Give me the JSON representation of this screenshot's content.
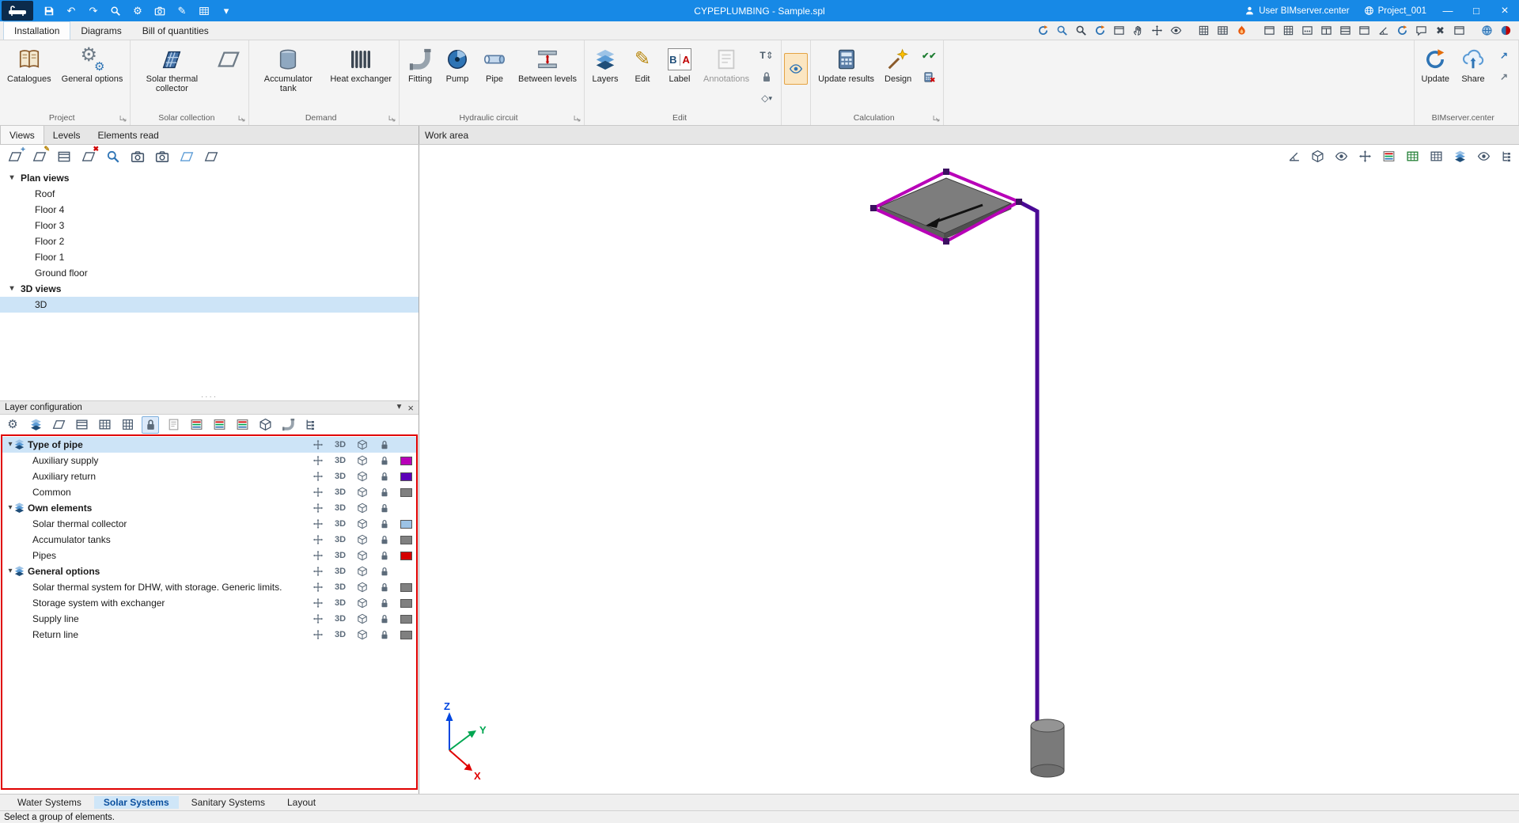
{
  "titlebar": {
    "title": "CYPEPLUMBING - Sample.spl",
    "user": "User BIMserver.center",
    "project": "Project_001"
  },
  "menu_tabs": {
    "installation": "Installation",
    "diagrams": "Diagrams",
    "bill": "Bill of quantities"
  },
  "ribbon": {
    "groups": {
      "project": "Project",
      "solar": "Solar collection",
      "demand": "Demand",
      "hydraulic": "Hydraulic circuit",
      "edit": "Edit",
      "calculation": "Calculation",
      "bim": "BIMserver.center"
    },
    "buttons": {
      "catalogues": "Catalogues",
      "general_options": "General options",
      "solar_collector": "Solar thermal collector",
      "accumulator_tank": "Accumulator tank",
      "heat_exchanger": "Heat exchanger",
      "fitting": "Fitting",
      "pump": "Pump",
      "pipe": "Pipe",
      "between_levels": "Between levels",
      "layers": "Layers",
      "edit": "Edit",
      "label": "Label",
      "annotations": "Annotations",
      "update_results": "Update results",
      "design": "Design",
      "update": "Update",
      "share": "Share"
    }
  },
  "caption": {
    "views": "Views",
    "levels": "Levels",
    "elements_read": "Elements read",
    "work_area": "Work area"
  },
  "tree": {
    "plan_views": "Plan views",
    "items": [
      "Roof",
      "Floor 4",
      "Floor 3",
      "Floor 2",
      "Floor 1",
      "Ground floor"
    ],
    "views3d": "3D views",
    "item3d": "3D"
  },
  "layers": {
    "title": "Layer configuration",
    "badge": "3D",
    "rows": [
      {
        "label": "Type of pipe",
        "group": true
      },
      {
        "label": "Auxiliary supply",
        "color": "#b800b8"
      },
      {
        "label": "Auxiliary return",
        "color": "#5c00b8"
      },
      {
        "label": "Common",
        "color": "#808080"
      },
      {
        "label": "Own elements",
        "group": true
      },
      {
        "label": "Solar thermal collector",
        "color": "#9cc3e6"
      },
      {
        "label": "Accumulator tanks",
        "color": "#808080"
      },
      {
        "label": "Pipes",
        "color": "#d40000"
      },
      {
        "label": "General options",
        "group": true
      },
      {
        "label": "Solar thermal system for DHW, with storage. Generic limits.",
        "color": "#808080"
      },
      {
        "label": "Storage system with exchanger",
        "color": "#808080"
      },
      {
        "label": "Supply line",
        "color": "#808080"
      },
      {
        "label": "Return line",
        "color": "#808080"
      }
    ]
  },
  "bottom_tabs": {
    "water": "Water Systems",
    "solar": "Solar Systems",
    "sanitary": "Sanitary Systems",
    "layout": "Layout"
  },
  "status": "Select a group of elements.",
  "axes": {
    "x": "X",
    "y": "Y",
    "z": "Z",
    "x_color": "#e00000",
    "y_color": "#00a651",
    "z_color": "#0046e0"
  },
  "scene": {
    "pipe_supply": "#b800b8",
    "pipe_return": "#4a0a96"
  },
  "colors": {
    "titlebar": "#1789e6",
    "selection": "#cde4f7",
    "highlight_border": "#e00000"
  },
  "icons": {
    "undo": "↶",
    "redo": "↷",
    "gear": "⚙",
    "pencil": "✎",
    "chev_down": "▾",
    "close": "×",
    "minimize": "—",
    "maximize": "□",
    "dots": "····",
    "checks": "✔✔",
    "redx": "✖",
    "label_b": "B",
    "label_a": "A",
    "diamond": "◇",
    "text_t": "T",
    "updown": "⇕",
    "plus": "+",
    "arrow_out": "↗"
  }
}
